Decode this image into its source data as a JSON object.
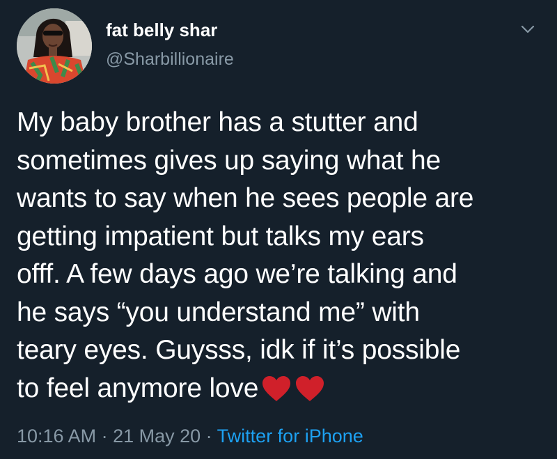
{
  "tweet": {
    "author": {
      "display_name": "fat belly shar",
      "handle": "@Sharbillionaire"
    },
    "text_lines": [
      "My baby brother has a stutter and",
      "sometimes gives up saying what he",
      "wants to say when he sees people are",
      "getting impatient but talks my ears",
      "offf. A few days ago we’re talking and",
      "he says “you understand me” with",
      "teary eyes. Guysss, idk if it’s possible",
      "to feel anymore love"
    ],
    "emoji": [
      "red-heart",
      "red-heart"
    ],
    "time": "10:16 AM",
    "separator": " · ",
    "date": "21 May 20",
    "source": "Twitter for iPhone"
  },
  "colors": {
    "background": "#15202b",
    "text": "#ffffff",
    "secondary": "#8899a6",
    "link": "#1da1f2",
    "heart": "#e0245e"
  }
}
